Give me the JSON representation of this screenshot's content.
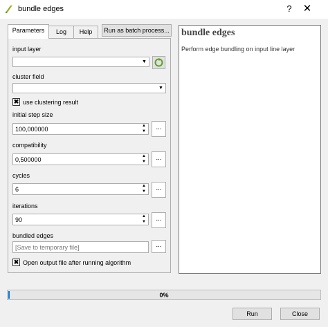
{
  "window": {
    "title": "bundle edges",
    "help_glyph": "?",
    "close_glyph": "✕"
  },
  "tabs": [
    {
      "label": "Parameters",
      "active": true
    },
    {
      "label": "Log",
      "active": false
    },
    {
      "label": "Help",
      "active": false
    }
  ],
  "batch_button": "Run as batch process...",
  "params": {
    "input_layer": {
      "label": "input layer",
      "value": ""
    },
    "cluster_field": {
      "label": "cluster field",
      "value": ""
    },
    "use_clustering": {
      "label": "use clustering result",
      "checked": true
    },
    "initial_step_size": {
      "label": "initial step size",
      "value": "100,000000"
    },
    "compatibility": {
      "label": "compatibility",
      "value": "0,500000"
    },
    "cycles": {
      "label": "cycles",
      "value": "6"
    },
    "iterations": {
      "label": "iterations",
      "value": "90"
    },
    "bundled_edges": {
      "label": "bundled edges",
      "placeholder": "[Save to temporary file]"
    },
    "open_output": {
      "label": "Open output file after running algorithm",
      "checked": true
    },
    "dots_label": "...",
    "check_glyph": "✖",
    "up_glyph": "▲",
    "down_glyph": "▼"
  },
  "help": {
    "title": "bundle edges",
    "description": "Perform edge bundling on input line layer"
  },
  "progress": {
    "value": 0,
    "text": "0%"
  },
  "buttons": {
    "run": "Run",
    "close": "Close"
  },
  "colors": {
    "accent": "#0078d7",
    "progress_fill": "#06b025",
    "iterate_icon": "#5ba12b"
  }
}
